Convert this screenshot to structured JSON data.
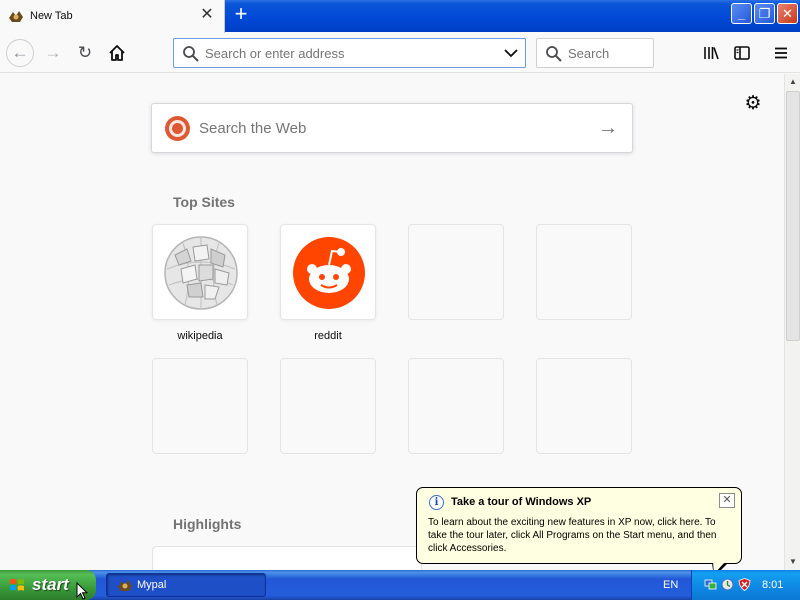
{
  "browser": {
    "tab": {
      "title": "New Tab",
      "close_glyph": "✕"
    },
    "new_tab_glyph": "+",
    "window_controls": {
      "minimize": "_",
      "maximize": "❐",
      "close": "✕"
    },
    "nav": {
      "back_glyph": "←",
      "forward_glyph": "→",
      "reload_glyph": "↻",
      "home_glyph": "⌂",
      "url_placeholder": "Search or enter address",
      "search_placeholder": "Search",
      "library_glyph": "|||\\",
      "sidebar_glyph": "▯",
      "menu_glyph": "☰"
    }
  },
  "newtab": {
    "settings_glyph": "⚙",
    "web_search_placeholder": "Search the Web",
    "web_search_go_glyph": "→",
    "top_sites_title": "Top Sites",
    "top_sites": [
      {
        "label": "wikipedia"
      },
      {
        "label": "reddit"
      }
    ],
    "highlights_title": "Highlights"
  },
  "balloon": {
    "info_glyph": "i",
    "title": "Take a tour of Windows XP",
    "close_glyph": "✕",
    "body": "To learn about the exciting new features in XP now, click here. To take the tour later, click All Programs on the Start menu, and then click Accessories."
  },
  "taskbar": {
    "start_label": "start",
    "task_label": "Mypal",
    "language": "EN",
    "clock": "8:01"
  },
  "colors": {
    "xp_blue": "#0048d6",
    "start_green": "#3a9a3a",
    "tray_blue": "#0f8be5",
    "duckduckgo": "#de5833",
    "reddit": "#ff4500",
    "balloon_bg": "#ffffe1"
  }
}
